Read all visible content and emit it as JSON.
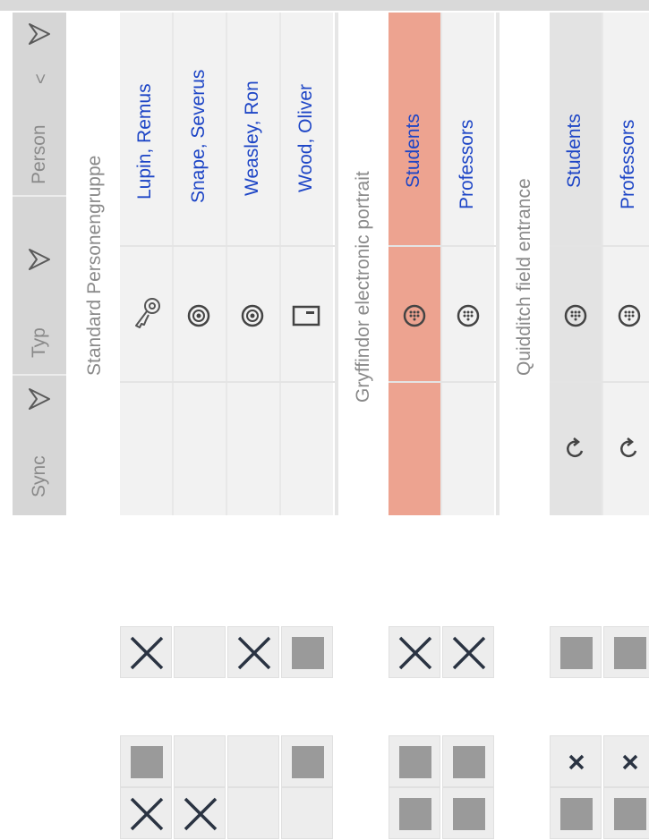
{
  "filters": {
    "sync_label": "Sync",
    "typ_label": "Typ",
    "person_label": "Person",
    "sort_indicator": "<"
  },
  "groups": [
    {
      "title": "Standard Personengruppe",
      "persons": [
        {
          "name": "Lupin, Remus",
          "type_icon": "key-transponder-icon",
          "sync_icon": ""
        },
        {
          "name": "Snape, Severus",
          "type_icon": "pin-code-transponder-icon",
          "sync_icon": ""
        },
        {
          "name": "Weasley, Ron",
          "type_icon": "pin-code-transponder-icon",
          "sync_icon": ""
        },
        {
          "name": "Wood, Oliver",
          "type_icon": "card-icon",
          "sync_icon": ""
        }
      ]
    },
    {
      "title": "Gryffindor electronic portrait",
      "persons": [
        {
          "name": "Students",
          "type_icon": "keypad-icon",
          "sync_icon": "",
          "selected": true
        },
        {
          "name": "Professors",
          "type_icon": "keypad-icon",
          "sync_icon": ""
        }
      ]
    },
    {
      "title": "Quidditch field entrance",
      "persons": [
        {
          "name": "Students",
          "type_icon": "keypad-icon",
          "sync_icon": "sync-icon"
        },
        {
          "name": "Professors",
          "type_icon": "keypad-icon",
          "sync_icon": "sync-icon"
        }
      ]
    }
  ],
  "matrix": {
    "row1": [
      "authorized-x",
      "empty",
      "authorized-x",
      "not-authorizable-square",
      "authorized-x",
      "authorized-x",
      "not-authorizable-square",
      "not-authorizable-square"
    ],
    "row2a": [
      "not-authorizable-square",
      "empty",
      "empty",
      "not-authorizable-square",
      "not-authorizable-square",
      "not-authorizable-square",
      "small-x",
      "small-x"
    ],
    "row2b": [
      "authorized-x",
      "authorized-x",
      "empty",
      "empty",
      "not-authorizable-square",
      "not-authorizable-square",
      "not-authorizable-square",
      "not-authorizable-square"
    ]
  },
  "colors": {
    "selected_column": "#eda390",
    "link_text": "#1d45c6",
    "filter_bar": "#d6d6d6"
  }
}
